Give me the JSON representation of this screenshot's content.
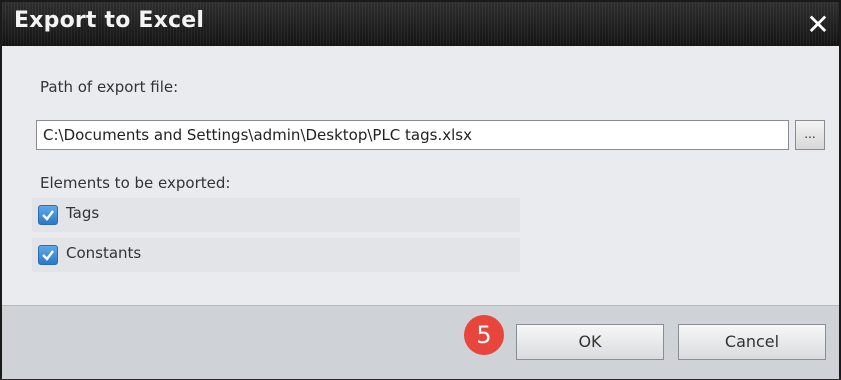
{
  "dialog": {
    "title": "Export to Excel",
    "close_symbol": "✕",
    "path_label": "Path of export file:",
    "path_value": "C:\\Documents and Settings\\admin\\Desktop\\PLC tags.xlsx",
    "browse_label": "...",
    "elements_label": "Elements to be exported:",
    "options": [
      {
        "label": "Tags",
        "checked": true
      },
      {
        "label": "Constants",
        "checked": true
      }
    ],
    "step_badge": "5",
    "ok_label": "OK",
    "cancel_label": "Cancel"
  },
  "icons": {
    "close": "close-icon",
    "checkbox": "checkmark-icon"
  },
  "colors": {
    "titlebar": "#1c1c1c",
    "dialog_body": "#e9ebee",
    "footer": "#cfd3d8",
    "checkbox": "#2c78c8",
    "badge": "#e8453c"
  }
}
